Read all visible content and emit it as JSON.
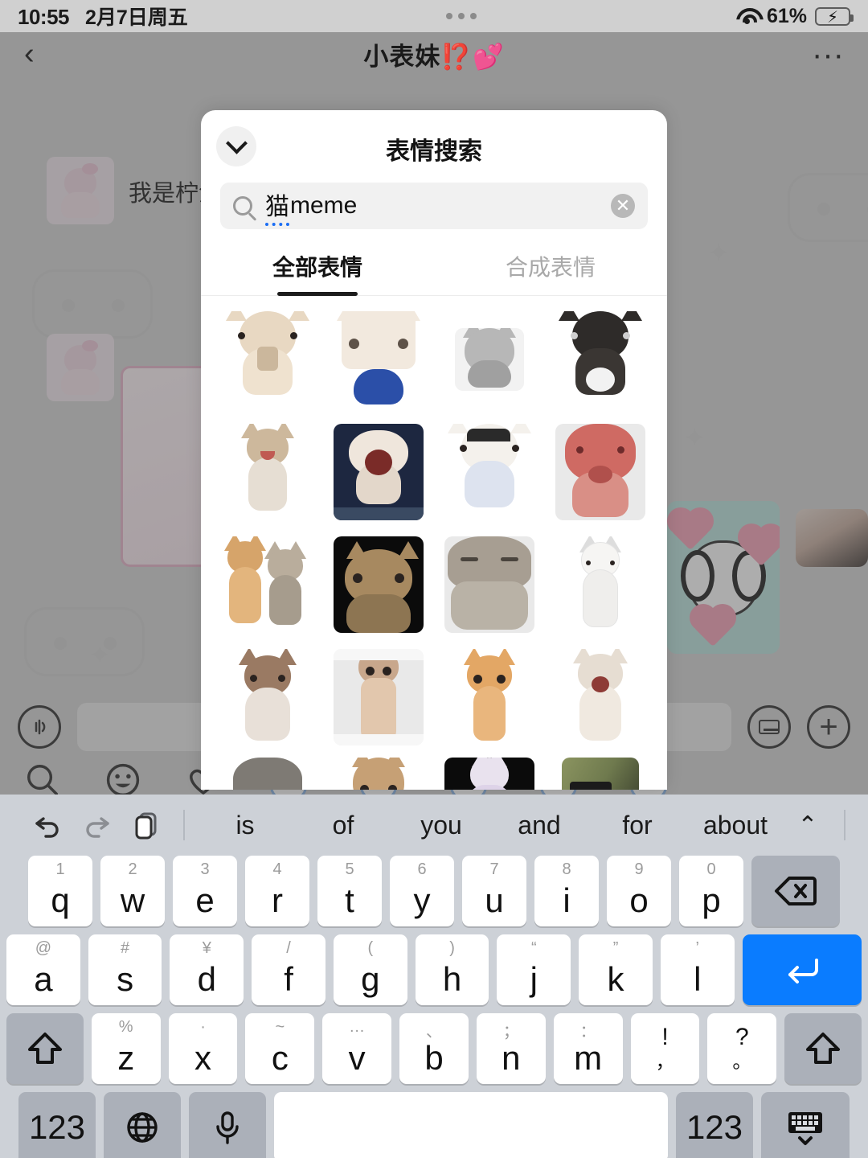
{
  "statusbar": {
    "time": "10:55",
    "date": "2月7日周五",
    "battery_percent": "61%",
    "wifi_icon": "wifi-icon",
    "battery_icon": "battery-charging-icon"
  },
  "navbar": {
    "back_icon": "chevron-left-icon",
    "title": "小表妹⁉️💕",
    "more_icon": "more-horizontal-icon"
  },
  "chat": {
    "message_text": "我是柠汐-梦",
    "input_voice_icon": "voice-wave-icon",
    "input_keyboard_icon": "keyboard-icon",
    "input_plus_icon": "plus-icon",
    "tray_search_icon": "search-icon",
    "tray_emoji_icon": "smiley-icon",
    "tray_favorite_icon": "heart-icon"
  },
  "modal": {
    "collapse_icon": "chevron-down-icon",
    "title": "表情搜索",
    "search": {
      "icon": "search-icon",
      "composing_text": "猫",
      "value": "meme",
      "clear_icon": "close-circle-icon"
    },
    "tabs": [
      {
        "label": "全部表情",
        "active": true
      },
      {
        "label": "合成表情",
        "active": false
      }
    ],
    "stickers": [
      {
        "name": "cream-cat-drinking-milk",
        "bg": "bg-white",
        "fur": "#e8d8c2",
        "body": "#efe2cf"
      },
      {
        "name": "white-cat-staring",
        "bg": "bg-white",
        "fur": "#f2e9de",
        "body": "#2b4fa8"
      },
      {
        "name": "gray-cat-squint-bw",
        "bg": "bg-gray",
        "fur": "#b7b7b7",
        "body": "#a0a0a0"
      },
      {
        "name": "black-white-kitten",
        "bg": "bg-white",
        "fur": "#2e2b29",
        "body": "#3a3633"
      },
      {
        "name": "kitten-meowing",
        "bg": "bg-white",
        "fur": "#cdb89c",
        "body": "#e6ded3"
      },
      {
        "name": "cat-screaming-navy",
        "bg": "bg-navy",
        "fur": "#efe6dc",
        "body": "#e3d7ca"
      },
      {
        "name": "white-cat-bowl-hat",
        "bg": "bg-white",
        "fur": "#f4f1ec",
        "body": "#dde3ef"
      },
      {
        "name": "pink-red-cat-closeup",
        "bg": "bg-lgray",
        "fur": "#cf6a63",
        "body": "#d98f86"
      },
      {
        "name": "two-cats-peeking",
        "bg": "bg-white",
        "fur": "#d6a46a",
        "body": "#b9ad9c"
      },
      {
        "name": "tabby-cat-dark-bg",
        "bg": "bg-black",
        "fur": "#a78960",
        "body": "#8d7552"
      },
      {
        "name": "cat-smiling-closeup",
        "bg": "bg-lgray",
        "fur": "#a79e92",
        "body": "#b9b2a6"
      },
      {
        "name": "white-cat-standing",
        "bg": "bg-white",
        "fur": "#f6f5f3",
        "body": "#eeeceA"
      },
      {
        "name": "brown-cat-sitting",
        "bg": "bg-white",
        "fur": "#9a7a63",
        "body": "#e8e0d8"
      },
      {
        "name": "tall-stretched-cat",
        "bg": "bg-lgray",
        "fur": "#c8a78c",
        "body": "#e2c7ad"
      },
      {
        "name": "orange-cat-peeking",
        "bg": "bg-white",
        "fur": "#dda košt",
        "body": "#e3a765"
      },
      {
        "name": "cat-mouth-open-jump",
        "bg": "bg-white",
        "fur": "#e6ddd2",
        "body": "#f0e9e0"
      },
      {
        "name": "gray-cat-blurred",
        "bg": "bg-white",
        "fur": "#7e7a74",
        "body": "#8c8880"
      },
      {
        "name": "tabby-cat-front",
        "bg": "bg-white",
        "fur": "#c6a075",
        "body": "#d0ab80"
      },
      {
        "name": "cat-with-hat-black-bg",
        "bg": "bg-black",
        "fur": "#e9e2ee",
        "body": "#ded3e8"
      },
      {
        "name": "cat-sunglasses-outdoor",
        "bg": "bg-white",
        "fur": "#6f7a4e",
        "body": "#8b9460"
      }
    ]
  },
  "keyboard": {
    "toolbar": {
      "undo_icon": "undo-icon",
      "redo_icon": "redo-icon",
      "paste_icon": "clipboard-icon",
      "suggestions": [
        "is",
        "of",
        "you",
        "and",
        "for",
        "about"
      ],
      "expand_icon": "chevron-up-icon"
    },
    "row1": [
      {
        "main": "q",
        "sub": "1"
      },
      {
        "main": "w",
        "sub": "2"
      },
      {
        "main": "e",
        "sub": "3"
      },
      {
        "main": "r",
        "sub": "4"
      },
      {
        "main": "t",
        "sub": "5"
      },
      {
        "main": "y",
        "sub": "6"
      },
      {
        "main": "u",
        "sub": "7"
      },
      {
        "main": "i",
        "sub": "8"
      },
      {
        "main": "o",
        "sub": "9"
      },
      {
        "main": "p",
        "sub": "0"
      }
    ],
    "row1_delete": "backspace-icon",
    "row2": [
      {
        "main": "a",
        "sub": "@"
      },
      {
        "main": "s",
        "sub": "#"
      },
      {
        "main": "d",
        "sub": "¥"
      },
      {
        "main": "f",
        "sub": "/"
      },
      {
        "main": "g",
        "sub": "("
      },
      {
        "main": "h",
        "sub": ")"
      },
      {
        "main": "j",
        "sub": "“"
      },
      {
        "main": "k",
        "sub": "”"
      },
      {
        "main": "l",
        "sub": "’"
      }
    ],
    "row2_enter": "return-icon",
    "row3_shift_left": "shift-icon",
    "row3": [
      {
        "main": "z",
        "sub": "%"
      },
      {
        "main": "x",
        "sub": "·"
      },
      {
        "main": "c",
        "sub": "~"
      },
      {
        "main": "v",
        "sub": "…"
      },
      {
        "main": "b",
        "sub": "、"
      },
      {
        "main": "n",
        "sub": "；"
      },
      {
        "main": "m",
        "sub": "："
      }
    ],
    "row3_punct1": {
      "top": "!",
      "bottom": "，"
    },
    "row3_punct2": {
      "top": "?",
      "bottom": "。"
    },
    "row3_shift_right": "shift-icon",
    "row4": {
      "num_left": "123",
      "globe_icon": "globe-icon",
      "mic_icon": "microphone-icon",
      "space": "",
      "num_right": "123",
      "dismiss_icon": "keyboard-dismiss-icon"
    }
  }
}
